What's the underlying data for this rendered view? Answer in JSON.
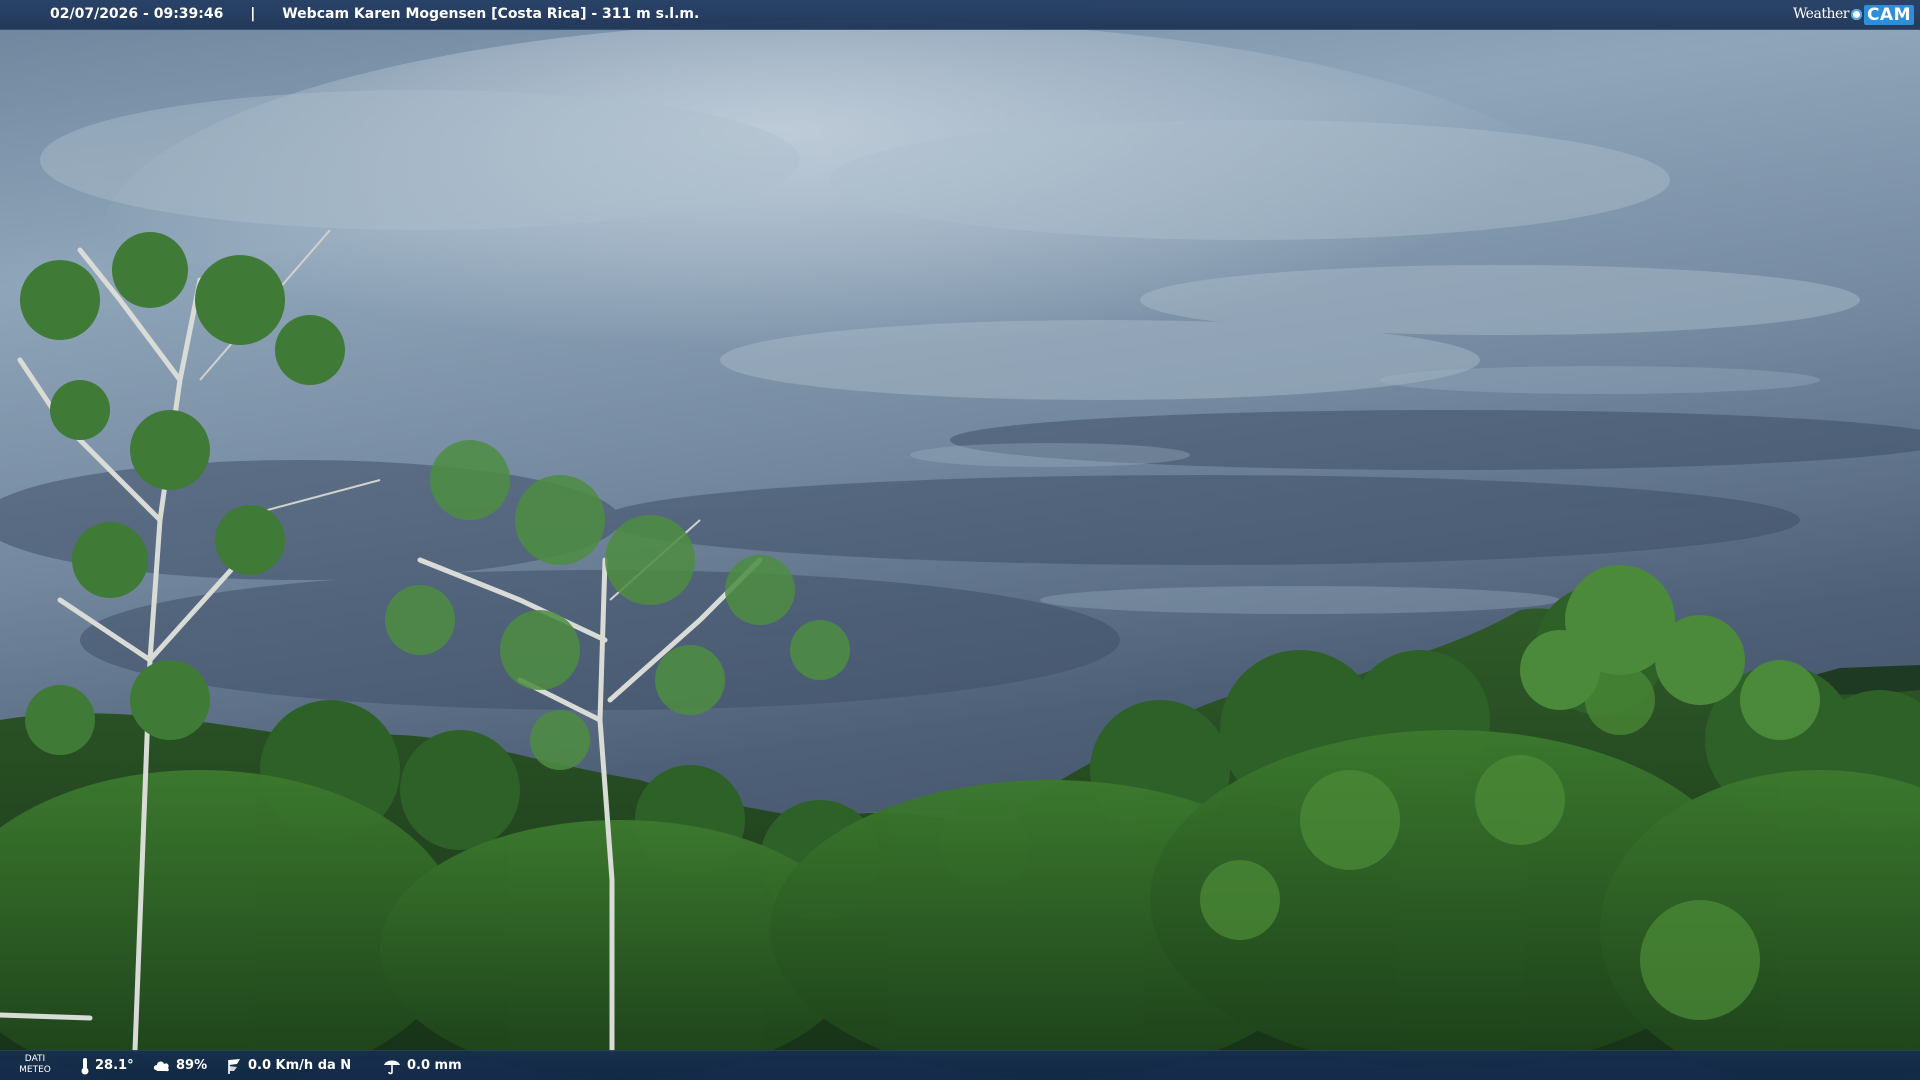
{
  "header": {
    "datetime": "02/07/2026 - 09:39:46",
    "separator": "|",
    "webcam_title": "Webcam Karen Mogensen [Costa Rica]  - 311 m s.l.m."
  },
  "logo": {
    "weather": "Weather",
    "cam": "CAM"
  },
  "footer": {
    "dati_line1": "DATI",
    "dati_line2": "METEO",
    "temperature": "28.1°",
    "humidity": "89%",
    "wind": "0.0 Km/h da N",
    "rain": "0.0 mm",
    "icons": [
      "thermometer-icon",
      "humidity-icon",
      "wind-icon",
      "rain-icon"
    ]
  },
  "colors": {
    "bar": "#22406a",
    "logo_accent": "#2f8ed8"
  }
}
